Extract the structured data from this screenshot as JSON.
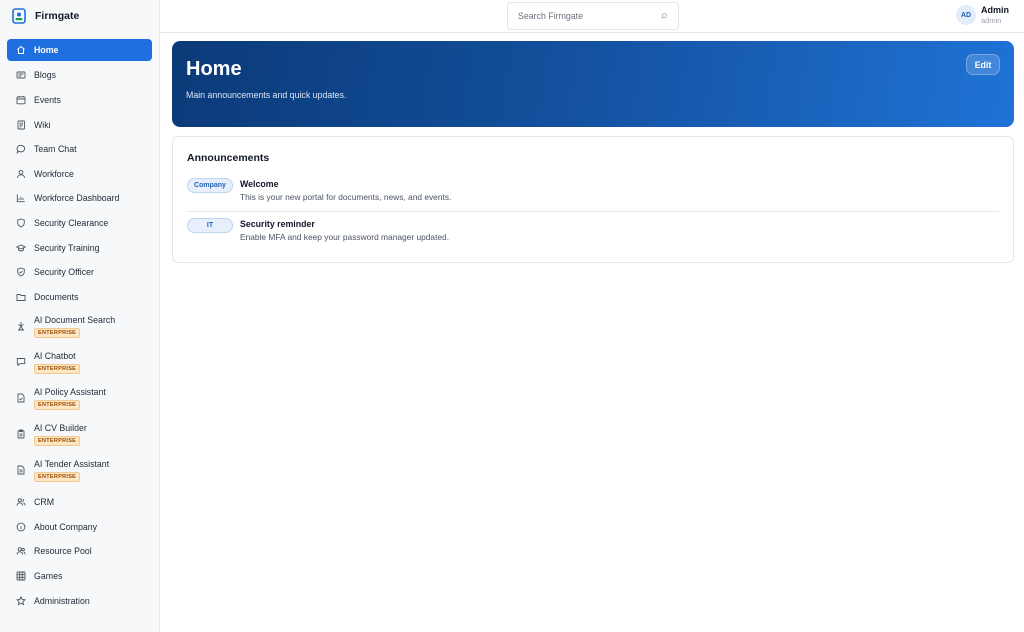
{
  "brand": {
    "name": "Firmgate"
  },
  "search": {
    "placeholder": "Search Firmgate"
  },
  "user": {
    "initials": "AD",
    "name": "Admin",
    "role": "admin"
  },
  "sidebar": {
    "items": [
      {
        "label": "Home",
        "icon": "home-icon",
        "active": true
      },
      {
        "label": "Blogs",
        "icon": "blog-icon"
      },
      {
        "label": "Events",
        "icon": "calendar-icon"
      },
      {
        "label": "Wiki",
        "icon": "book-icon"
      },
      {
        "label": "Team Chat",
        "icon": "chat-bubble-icon"
      },
      {
        "label": "Workforce",
        "icon": "user-icon"
      },
      {
        "label": "Workforce Dashboard",
        "icon": "chart-icon"
      },
      {
        "label": "Security Clearance",
        "icon": "shield-icon"
      },
      {
        "label": "Security Training",
        "icon": "graduation-cap-icon"
      },
      {
        "label": "Security Officer",
        "icon": "shield-check-icon"
      },
      {
        "label": "Documents",
        "icon": "folder-icon"
      },
      {
        "label": "AI Document Search",
        "icon": "document-search-icon",
        "badge": "ENTERPRISE"
      },
      {
        "label": "AI Chatbot",
        "icon": "chatbot-icon",
        "badge": "ENTERPRISE"
      },
      {
        "label": "AI Policy Assistant",
        "icon": "policy-doc-icon",
        "badge": "ENTERPRISE"
      },
      {
        "label": "AI CV Builder",
        "icon": "clipboard-icon",
        "badge": "ENTERPRISE"
      },
      {
        "label": "AI Tender Assistant",
        "icon": "tender-doc-icon",
        "badge": "ENTERPRISE"
      },
      {
        "label": "CRM",
        "icon": "users-icon"
      },
      {
        "label": "About Company",
        "icon": "info-icon"
      },
      {
        "label": "Resource Pool",
        "icon": "people-icon"
      },
      {
        "label": "Games",
        "icon": "grid-icon"
      },
      {
        "label": "Administration",
        "icon": "star-icon"
      }
    ]
  },
  "hero": {
    "title": "Home",
    "subtitle": "Main announcements and quick updates.",
    "edit_label": "Edit"
  },
  "announcements": {
    "title": "Announcements",
    "items": [
      {
        "tag": "Company",
        "title": "Welcome",
        "body": "This is your new portal for documents, news, and events."
      },
      {
        "tag": "IT",
        "title": "Security reminder",
        "body": "Enable MFA and keep your password manager updated."
      }
    ]
  },
  "colors": {
    "accent": "#1e6fe0",
    "hero_start": "#0b3a78",
    "hero_end": "#1f73d6",
    "badge_bg": "#fde6c4"
  }
}
